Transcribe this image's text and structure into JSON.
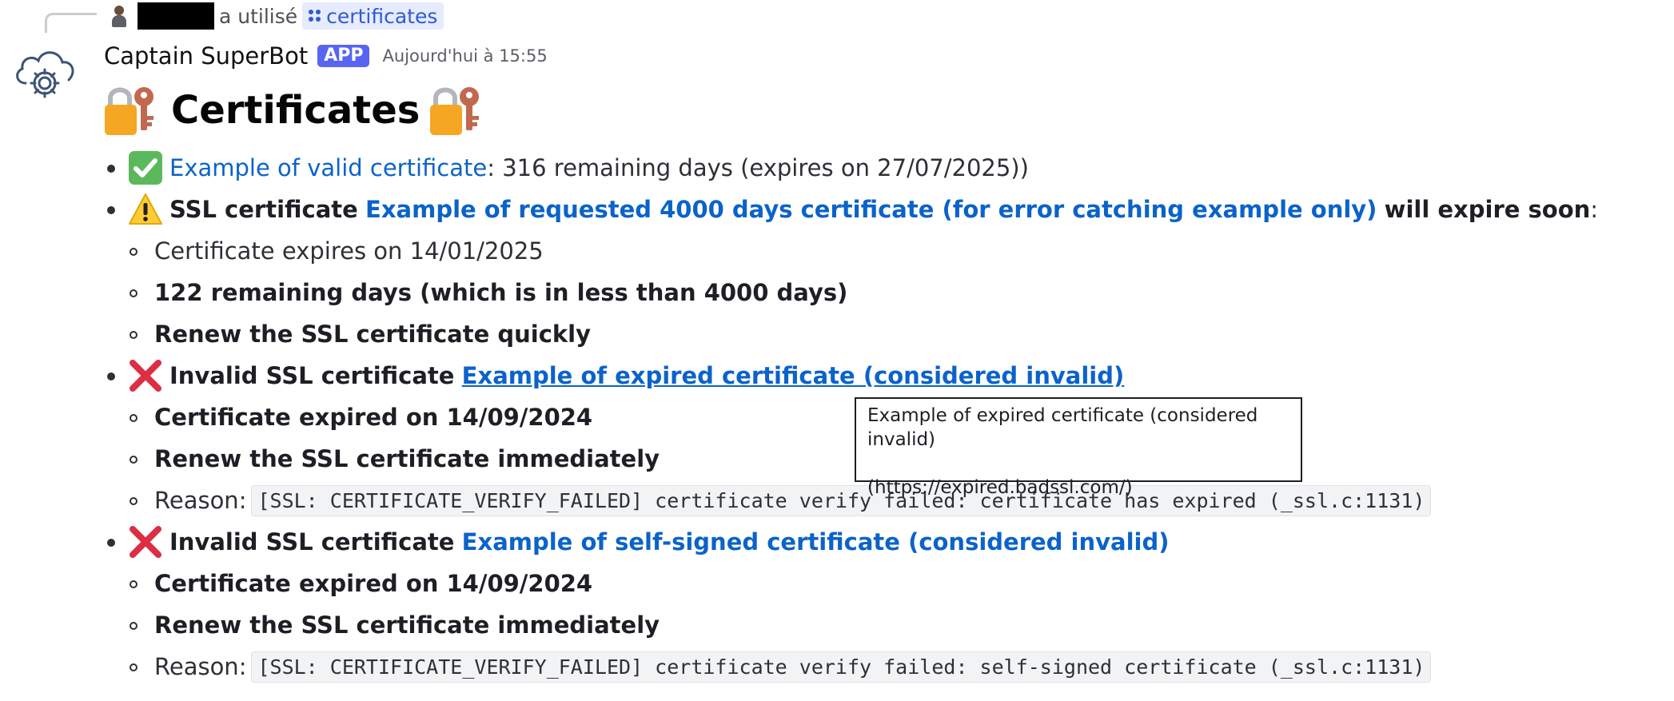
{
  "reply": {
    "used_text": "a utilisé",
    "command": "certificates"
  },
  "message": {
    "username": "Captain SuperBot",
    "badge": "APP",
    "timestamp": "Aujourd'hui à 15:55",
    "title": "Certificates"
  },
  "items": {
    "valid": {
      "link": "Example of valid certificate",
      "rest": ": 316 remaining days (expires on 27/07/2025))"
    },
    "warning": {
      "prefix": "SSL certificate",
      "link": "Example of requested 4000 days certificate (for error catching example only)",
      "suffix": "will expire soon",
      "colon": ":",
      "sub1": "Certificate expires on 14/01/2025",
      "sub2": "122 remaining days (which is in less than 4000 days)",
      "sub3": "Renew the SSL certificate quickly"
    },
    "expired": {
      "prefix": "Invalid SSL certificate",
      "link": "Example of expired certificate (considered invalid)",
      "sub1": "Certificate expired on 14/09/2024",
      "sub2": "Renew the SSL certificate immediately",
      "reason_label": "Reason:",
      "reason_code": "[SSL: CERTIFICATE_VERIFY_FAILED] certificate verify failed: certificate has expired (_ssl.c:1131)"
    },
    "selfsigned": {
      "prefix": "Invalid SSL certificate",
      "link": "Example of self-signed certificate (considered invalid)",
      "sub1": "Certificate expired on 14/09/2024",
      "sub2": "Renew the SSL certificate immediately",
      "reason_label": "Reason:",
      "reason_code": "[SSL: CERTIFICATE_VERIFY_FAILED] certificate verify failed: self-signed certificate (_ssl.c:1131)"
    }
  },
  "tooltip": {
    "line1": "Example of expired certificate (considered invalid)",
    "line2": "(https://expired.badssl.com/)"
  },
  "icons": {
    "reply_avatar": "user-avatar-icon",
    "command": "slash-command-icon",
    "bot_avatar": "cloud-gear-icon",
    "title_emoji": "locked-with-key-icon",
    "valid_emoji": "check-mark-button-icon",
    "warning_emoji": "warning-icon",
    "invalid_emoji": "cross-mark-icon"
  },
  "colors": {
    "link": "#0b63c9",
    "badge": "#5865f2",
    "check_green": "#5cb85c",
    "warning_yellow": "#ffcc33",
    "cross_red": "#dd2e44"
  }
}
